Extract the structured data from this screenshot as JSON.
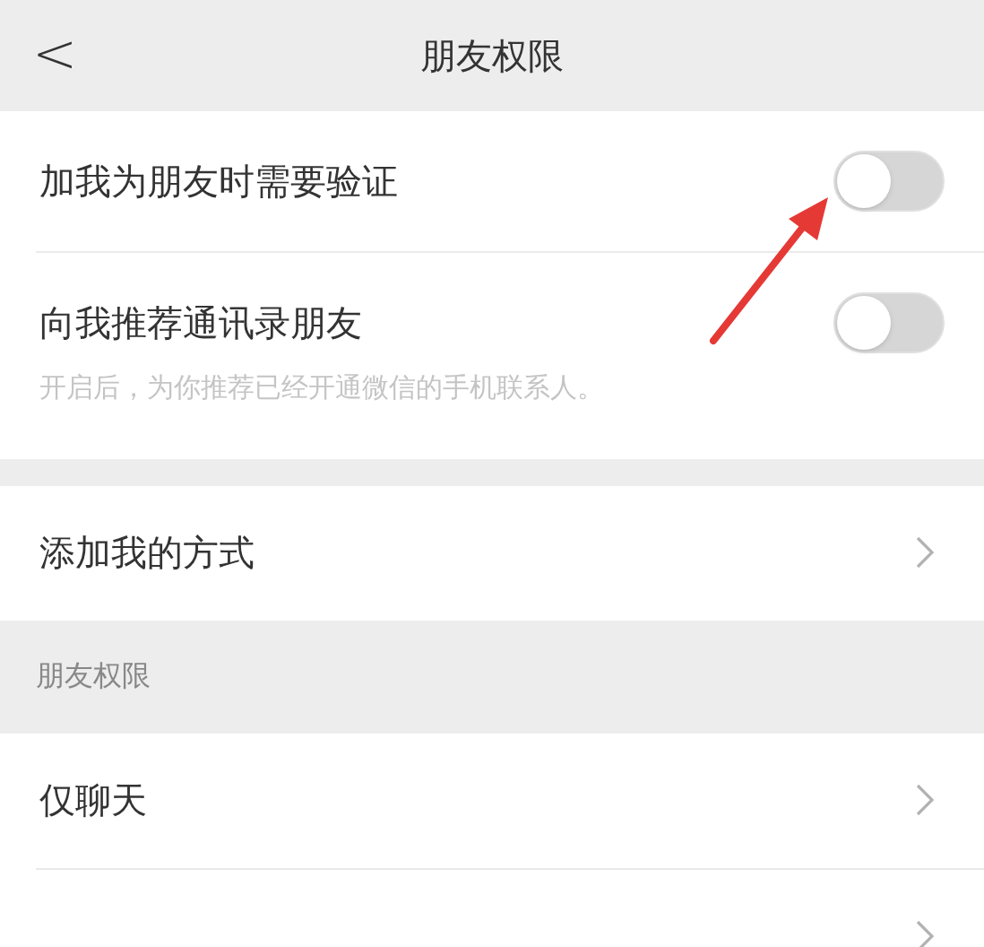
{
  "header": {
    "back": "<",
    "title": "朋友权限"
  },
  "toggles": [
    {
      "label": "加我为朋友时需要验证",
      "on": false
    },
    {
      "label": "向我推荐通讯录朋友",
      "on": false,
      "hint": "开启后，为你推荐已经开通微信的手机联系人。"
    }
  ],
  "add_methods": {
    "label": "添加我的方式"
  },
  "section": {
    "title": "朋友权限",
    "items": [
      {
        "kind": "item",
        "label": "仅聊天"
      },
      {
        "kind": "cut"
      }
    ]
  }
}
